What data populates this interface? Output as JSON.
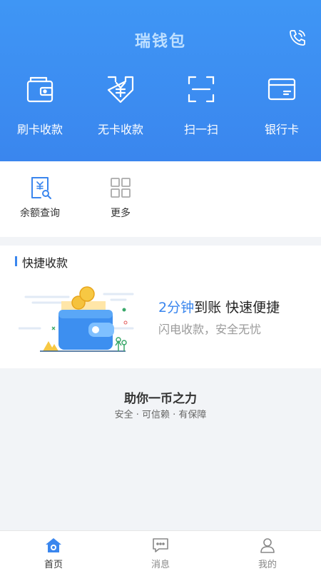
{
  "header": {
    "app_title": "瑞钱包",
    "phone_icon": "phone-call-icon",
    "actions": [
      {
        "label": "刷卡收款",
        "icon": "wallet-card-icon"
      },
      {
        "label": "无卡收款",
        "icon": "yuan-download-icon"
      },
      {
        "label": "扫一扫",
        "icon": "scan-icon"
      },
      {
        "label": "银行卡",
        "icon": "bank-card-icon"
      }
    ]
  },
  "tools": [
    {
      "label": "余额查询",
      "icon": "balance-search-icon"
    },
    {
      "label": "更多",
      "icon": "grid-more-icon"
    }
  ],
  "quick_pay": {
    "title": "快捷收款",
    "headline_highlight": "2分钟",
    "headline_rest": "到账  快速便捷",
    "subtitle": "闪电收款，安全无忧"
  },
  "slogan": {
    "title": "助你一币之力",
    "subtitle": "安全 · 可信赖 · 有保障"
  },
  "tabbar": [
    {
      "label": "首页",
      "icon": "home-icon",
      "active": true
    },
    {
      "label": "消息",
      "icon": "message-icon",
      "active": false
    },
    {
      "label": "我的",
      "icon": "user-icon",
      "active": false
    }
  ],
  "colors": {
    "primary": "#3a86ee",
    "header_top": "#3f96f5",
    "background": "#f2f4f7"
  }
}
